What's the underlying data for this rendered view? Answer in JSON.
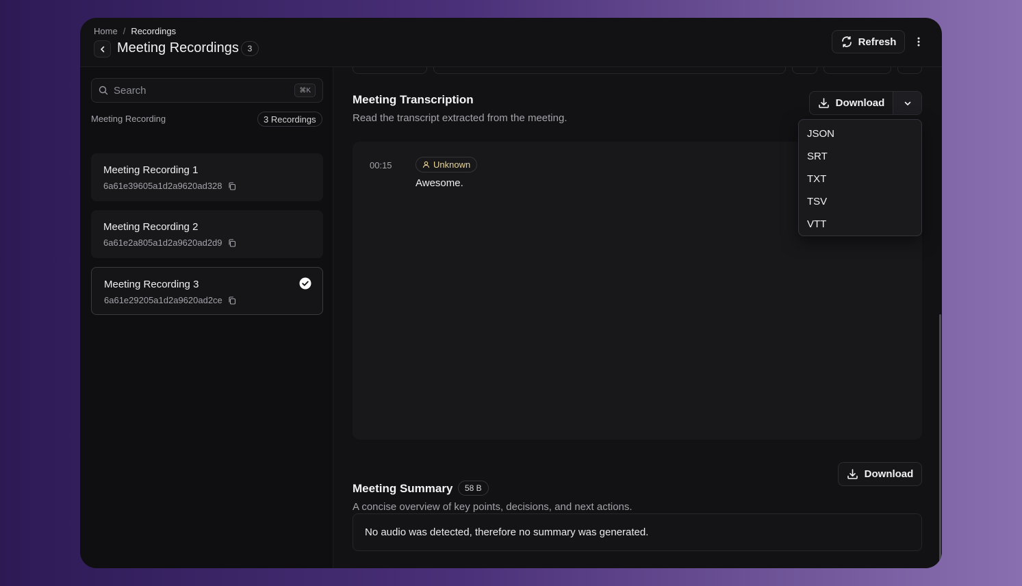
{
  "header": {
    "breadcrumb": [
      "Home",
      "Recordings"
    ],
    "breadcrumb_separator": "/",
    "title": "Meeting Recordings",
    "count": "3",
    "refresh_label": "Refresh"
  },
  "sidebar": {
    "search": {
      "placeholder": "Search",
      "shortcut": "⌘K"
    },
    "section_label": "Meeting Recording",
    "recordings_count": "3 Recordings",
    "recordings": [
      {
        "title": "Meeting Recording 1",
        "id": "6a61e39605a1d2a9620ad328",
        "selected": false
      },
      {
        "title": "Meeting Recording 2",
        "id": "6a61e2a805a1d2a9620ad2d9",
        "selected": false
      },
      {
        "title": "Meeting Recording 3",
        "id": "6a61e29205a1d2a9620ad2ce",
        "selected": true
      }
    ]
  },
  "transcription": {
    "title": "Meeting Transcription",
    "description": "Read the transcript extracted from the meeting.",
    "download_label": "Download",
    "menu_options": [
      "JSON",
      "SRT",
      "TXT",
      "TSV",
      "VTT"
    ],
    "entries": [
      {
        "time": "00:15",
        "speaker": "Unknown",
        "text": "Awesome."
      }
    ]
  },
  "summary": {
    "title": "Meeting Summary",
    "size": "58 B",
    "description": "A concise overview of key points, decisions, and next actions.",
    "download_label": "Download",
    "content": "No audio was detected, therefore no summary was generated."
  },
  "colors": {
    "window_bg": "#121214",
    "sidebar_bg": "#0f0f11",
    "speaker_accent": "#e8d59a",
    "frame_gradient_start": "#2d1a55",
    "frame_gradient_end": "#8a6fb0"
  },
  "icons": {
    "back": "chevron-left-icon",
    "refresh": "refresh-icon",
    "more": "more-vertical-icon",
    "search": "search-icon",
    "copy": "copy-icon",
    "selected": "check-circle-icon",
    "download": "download-icon",
    "dropdown": "chevron-down-icon",
    "speaker": "user-icon"
  }
}
